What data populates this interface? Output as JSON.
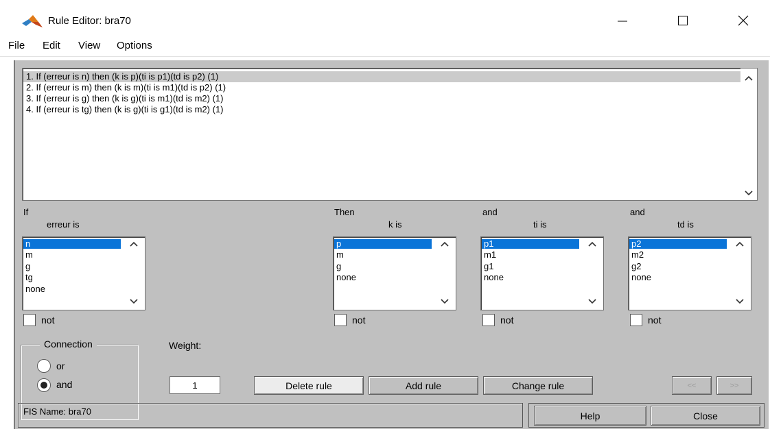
{
  "window": {
    "title": "Rule Editor: bra70",
    "controls": {
      "minimize": "minimize-icon",
      "maximize": "maximize-icon",
      "close": "close-icon"
    }
  },
  "menu": {
    "file": "File",
    "edit": "Edit",
    "view": "View",
    "options": "Options"
  },
  "rules": [
    "1. If (erreur is n) then (k is p)(ti is p1)(td is p2) (1)",
    "2. If (erreur is m) then (k is m)(ti is m1)(td is p2) (1)",
    "3. If (erreur is g) then (k is g)(ti is m1)(td is m2) (1)",
    "4. If (erreur is tg) then (k is g)(ti is g1)(td is m2) (1)"
  ],
  "selected_rule": 0,
  "if_section": {
    "header": "If",
    "var_label": "erreur is",
    "options": [
      "n",
      "m",
      "g",
      "tg",
      "none"
    ],
    "selected": 0,
    "not_label": "not"
  },
  "then_section": {
    "header": "Then",
    "var_label": "k is",
    "options": [
      "p",
      "m",
      "g",
      "none"
    ],
    "selected": 0,
    "not_label": "not"
  },
  "and_ti_section": {
    "header": "and",
    "var_label": "ti is",
    "options": [
      "p1",
      "m1",
      "g1",
      "none"
    ],
    "selected": 0,
    "not_label": "not"
  },
  "and_td_section": {
    "header": "and",
    "var_label": "td is",
    "options": [
      "p2",
      "m2",
      "g2",
      "none"
    ],
    "selected": 0,
    "not_label": "not"
  },
  "connection": {
    "title": "Connection",
    "or_label": "or",
    "and_label": "and",
    "selected": "and"
  },
  "weight": {
    "label": "Weight:",
    "value": "1"
  },
  "buttons": {
    "delete_rule": "Delete rule",
    "add_rule": "Add rule",
    "change_rule": "Change rule",
    "prev": "<<",
    "next": ">>",
    "help": "Help",
    "close": "Close"
  },
  "status": {
    "fis_name": "FIS Name: bra70"
  },
  "colors": {
    "panel": "#c0c0c0",
    "selection": "#0a74d8",
    "rule_selection": "#cbcbcb"
  }
}
